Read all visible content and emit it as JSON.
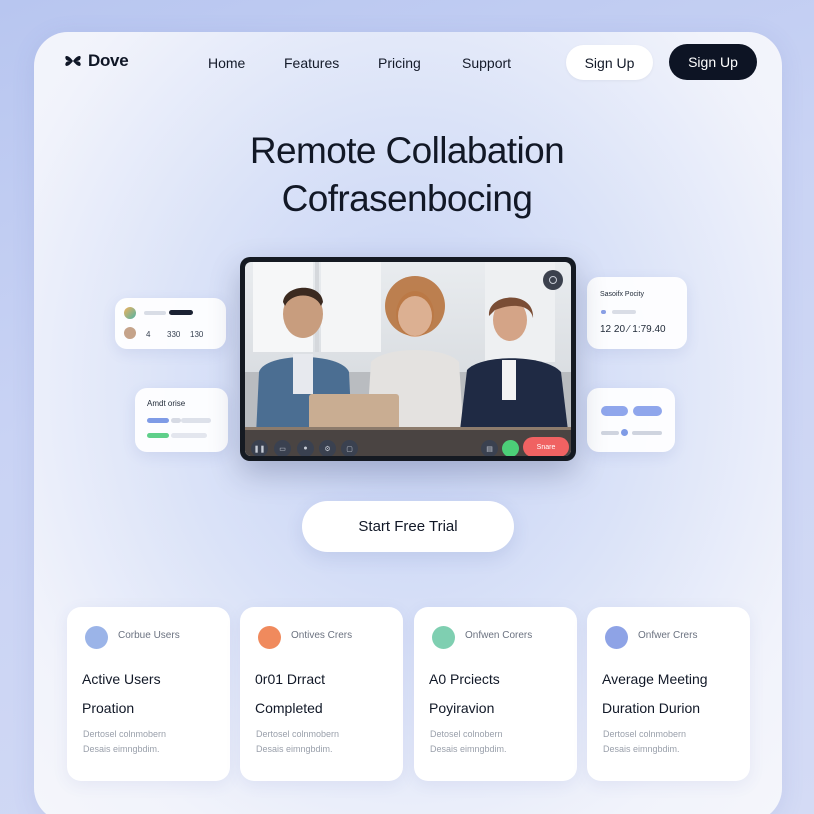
{
  "brand": {
    "name": "Dove"
  },
  "nav": {
    "items": [
      "Home",
      "Features",
      "Pricing",
      "Support"
    ]
  },
  "auth": {
    "signup_light": "Sign Up",
    "signup_dark": "Sign Up"
  },
  "hero": {
    "line1": "Remote Collabation",
    "line2": "Cofrasenbocing"
  },
  "video_call": {
    "end_label": "Snare"
  },
  "floating_cards": {
    "left_top": {
      "val1": "4",
      "val2": "330",
      "val3": "130"
    },
    "left_mid": {
      "title": "Amdt orise"
    },
    "right_top": {
      "title": "Sasoifx Pocity",
      "value": "12 20 ⁄ 1:79.40"
    }
  },
  "cta": {
    "label": "Start Free Trial"
  },
  "stats": [
    {
      "tag": "Corbue Users",
      "line1": "Active Users",
      "line2": "Proation",
      "desc1": "Dertosel colnmobern",
      "desc2": "Desais eimngbdim.",
      "avatar_color": "#9bb4e8"
    },
    {
      "tag": "Ontives Crers",
      "line1": "0r01   Drract",
      "line2": "Completed",
      "desc1": "Dertosel colnmobern",
      "desc2": "Desais eimngbdim.",
      "avatar_color": "#f08a5d"
    },
    {
      "tag": "Onfwen Corers",
      "line1": "A0 Prciects",
      "line2": "Poyiravion",
      "desc1": "Detosel colnobern",
      "desc2": "Desais eimngbdim.",
      "avatar_color": "#7fcfb1"
    },
    {
      "tag": "Onfwer Crers",
      "line1": "Average Meeting",
      "line2": "Duration Durion",
      "desc1": "Dertosel colnmobern",
      "desc2": "Desais eimngbdim.",
      "avatar_color": "#8ea3e6"
    }
  ],
  "colors": {
    "dark": "#0d1424",
    "end_call": "#f06262",
    "accent_blue": "#7f9be6",
    "accent_green": "#5fcf8a"
  }
}
